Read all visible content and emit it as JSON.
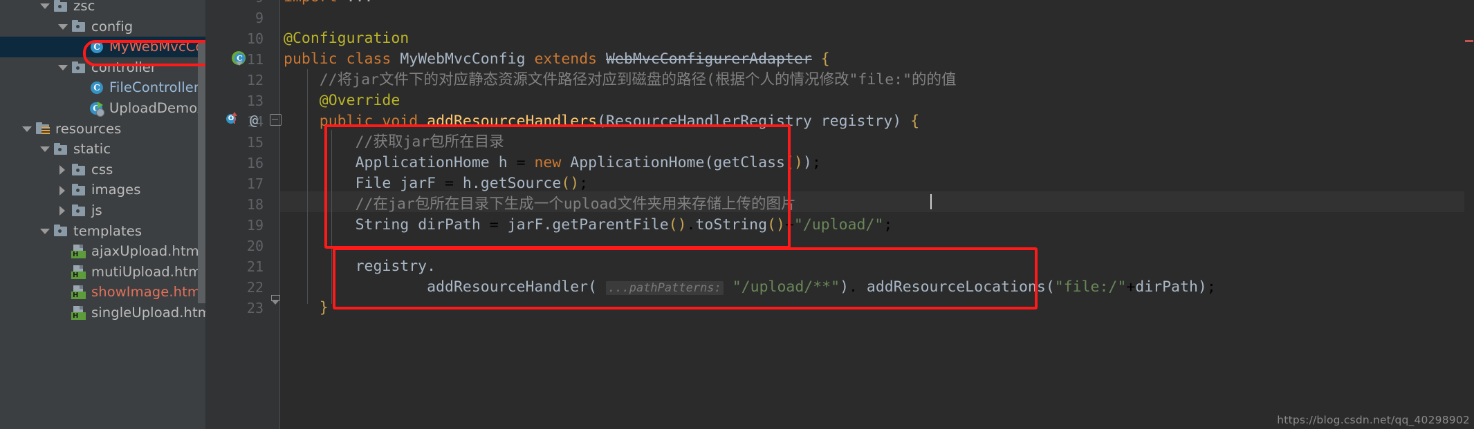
{
  "app": {
    "theme": "darcula",
    "accent_red": "#ff1a1a",
    "editor_bg": "#2b2b2b",
    "tree_bg": "#3c3f41",
    "selection_bg": "#0d293e"
  },
  "project_tree": {
    "items": [
      {
        "label": "zsc",
        "indent": 2,
        "arrow": "down",
        "icon": "folder-icon",
        "color": "grey",
        "selected": false
      },
      {
        "label": "config",
        "indent": 3,
        "arrow": "down",
        "icon": "folder-icon",
        "color": "grey",
        "selected": false
      },
      {
        "label": "MyWebMvcConfi",
        "indent": 4,
        "arrow": "none",
        "icon": "java-class-icon",
        "color": "red",
        "selected": true
      },
      {
        "label": "controller",
        "indent": 3,
        "arrow": "down",
        "icon": "folder-icon",
        "color": "grey",
        "selected": false
      },
      {
        "label": "FileController",
        "indent": 4,
        "arrow": "none",
        "icon": "java-class-icon",
        "color": "blue",
        "selected": false
      },
      {
        "label": "UploadDemoApplica",
        "indent": 4,
        "arrow": "none",
        "icon": "spring-boot-class-icon",
        "color": "grey",
        "selected": false
      },
      {
        "label": "resources",
        "indent": 1,
        "arrow": "down",
        "icon": "resources-folder-icon",
        "color": "grey",
        "selected": false
      },
      {
        "label": "static",
        "indent": 2,
        "arrow": "down",
        "icon": "folder-icon",
        "color": "grey",
        "selected": false
      },
      {
        "label": "css",
        "indent": 3,
        "arrow": "right",
        "icon": "folder-icon",
        "color": "grey",
        "selected": false
      },
      {
        "label": "images",
        "indent": 3,
        "arrow": "right",
        "icon": "folder-icon",
        "color": "grey",
        "selected": false
      },
      {
        "label": "js",
        "indent": 3,
        "arrow": "right",
        "icon": "folder-icon",
        "color": "grey",
        "selected": false
      },
      {
        "label": "templates",
        "indent": 2,
        "arrow": "down",
        "icon": "folder-icon",
        "color": "grey",
        "selected": false
      },
      {
        "label": "ajaxUpload.html",
        "indent": 3,
        "arrow": "none",
        "icon": "html-file-icon",
        "color": "grey",
        "selected": false
      },
      {
        "label": "mutiUpload.html",
        "indent": 3,
        "arrow": "none",
        "icon": "html-file-icon",
        "color": "grey",
        "selected": false
      },
      {
        "label": "showImage.html",
        "indent": 3,
        "arrow": "none",
        "icon": "html-file-icon",
        "color": "red",
        "selected": false
      },
      {
        "label": "singleUpload.html",
        "indent": 3,
        "arrow": "none",
        "icon": "html-file-icon",
        "color": "grey",
        "selected": false
      }
    ]
  },
  "editor": {
    "file": "MyWebMvcConfig.java",
    "lines": [
      {
        "num": "9",
        "text": "import ..."
      },
      {
        "num": "9",
        "text": ""
      },
      {
        "num": "10",
        "text": "@Configuration"
      },
      {
        "num": "11",
        "text": "public class MyWebMvcConfig extends WebMvcConfigurerAdapter {"
      },
      {
        "num": "12",
        "text": "    //将jar文件下的对应静态资源文件路径对应到磁盘的路径(根据个人的情况修改\"file:\"的的值"
      },
      {
        "num": "13",
        "text": "    @Override"
      },
      {
        "num": "14",
        "text": "    public void addResourceHandlers(ResourceHandlerRegistry registry) {"
      },
      {
        "num": "15",
        "text": "        //获取jar包所在目录"
      },
      {
        "num": "16",
        "text": "        ApplicationHome h = new ApplicationHome(getClass());"
      },
      {
        "num": "17",
        "text": "        File jarF = h.getSource();"
      },
      {
        "num": "18",
        "text": "        //在jar包所在目录下生成一个upload文件夹用来存储上传的图片"
      },
      {
        "num": "19",
        "text": "        String dirPath = jarF.getParentFile().toString()+\"/upload/\";"
      },
      {
        "num": "20",
        "text": ""
      },
      {
        "num": "21",
        "text": "        registry."
      },
      {
        "num": "22",
        "text": "                addResourceHandler( ...pathPatterns: \"/upload/**\"). addResourceLocations(\"file:/\"+dirPath);"
      },
      {
        "num": "23",
        "text": "    }"
      }
    ],
    "tokens": {
      "import_kw": "import",
      "import_ellipsis": "...",
      "ann_configuration": "@Configuration",
      "kw_public": "public",
      "kw_class": "class",
      "cls_MyWebMvcConfig": "MyWebMvcConfig",
      "kw_extends": "extends",
      "cls_WebMvcConfigurerAdapter": "WebMvcConfigurerAdapter",
      "brace_open": "{",
      "comment_line12": "//将jar文件下的对应静态资源文件路径对应到磁盘的路径(根据个人的情况修改\"file:\"的的值",
      "ann_override": "@Override",
      "kw_void": "void",
      "method_addResourceHandlers": "addResourceHandlers",
      "param_type_ResourceHandlerRegistry": "ResourceHandlerRegistry",
      "param_name_registry": "registry",
      "comment_line15": "//获取jar包所在目录",
      "cls_ApplicationHome": "ApplicationHome",
      "var_h": "h",
      "kw_new": "new",
      "call_ApplicationHome": "ApplicationHome",
      "call_getClass": "getClass",
      "cls_File": "File",
      "var_jarF": "jarF",
      "call_getSource": "h.getSource",
      "comment_line18": "//在jar包所在目录下生成一个upload文件夹用来存储上传的图片",
      "cls_String": "String",
      "var_dirPath": "dirPath",
      "call_getParentFile": "jarF.getParentFile",
      "call_toString": "toString",
      "str_upload_path": "\"/upload/\"",
      "var_registry": "registry.",
      "call_addResourceHandler": "addResourceHandler",
      "hint_pathPatterns": "...pathPatterns:",
      "str_pattern": "\"/upload/**\"",
      "call_addResourceLocations": "addResourceLocations",
      "str_file_prefix": "\"file:/\"",
      "plus": "+",
      "semicolon": ";",
      "brace_close": "}"
    }
  },
  "watermark": {
    "text": "https://blog.csdn.net/qq_40298902"
  }
}
